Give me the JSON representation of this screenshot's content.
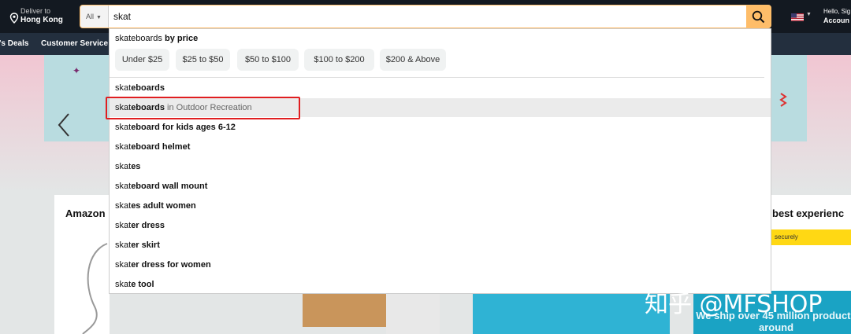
{
  "header": {
    "deliver_label": "Deliver to",
    "deliver_location": "Hong Kong",
    "search_scope": "All",
    "search_query": "skat",
    "account_greeting": "Hello, Sig",
    "account_label": "Accoun"
  },
  "subnav": {
    "items": [
      "'s Deals",
      "Customer Service"
    ]
  },
  "dropdown": {
    "price_term": "skateboards",
    "price_suffix": "by price",
    "price_chips": [
      "Under $25",
      "$25 to $50",
      "$50 to $100",
      "$100 to $200",
      "$200 & Above"
    ],
    "suggestions": [
      {
        "prefix": "skat",
        "bold": "eboards",
        "category": ""
      },
      {
        "prefix": "skat",
        "bold": "eboards",
        "category": " in Outdoor Recreation",
        "highlighted": true
      },
      {
        "prefix": "skat",
        "bold": "eboard for kids ages 6-12",
        "category": ""
      },
      {
        "prefix": "skat",
        "bold": "eboard helmet",
        "category": ""
      },
      {
        "prefix": "skat",
        "bold": "es",
        "category": ""
      },
      {
        "prefix": "skat",
        "bold": "eboard wall mount",
        "category": ""
      },
      {
        "prefix": "skat",
        "bold": "es adult women",
        "category": ""
      },
      {
        "prefix": "skat",
        "bold": "er dress",
        "category": ""
      },
      {
        "prefix": "skat",
        "bold": "er skirt",
        "category": ""
      },
      {
        "prefix": "skat",
        "bold": "er dress for women",
        "category": ""
      },
      {
        "prefix": "skat",
        "bold": "e tool",
        "category": ""
      }
    ]
  },
  "background": {
    "card_left_title": "Amazon",
    "card_right_title": "best experienc",
    "secure_text": "securely",
    "ship_text": "We ship over 45 million products around"
  },
  "watermark": "知乎 @MFSHOP",
  "colors": {
    "nav_dark": "#131921",
    "nav_secondary": "#232f3e",
    "search_button": "#febd69",
    "highlight_box": "#e01e20"
  },
  "icons": {
    "location": "location-pin-icon",
    "search": "search-icon",
    "flag": "us-flag-icon",
    "carousel_prev": "chevron-left-icon"
  }
}
